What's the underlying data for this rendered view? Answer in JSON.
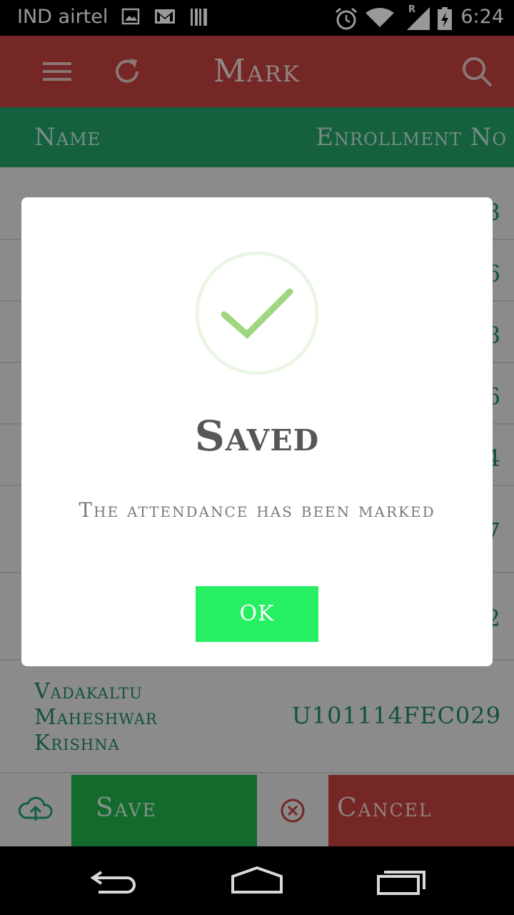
{
  "status_bar": {
    "carrier": "IND airtel",
    "time": "6:24",
    "roaming_indicator": "R",
    "icons": [
      "image-icon",
      "gmail-icon",
      "barcode-icon",
      "alarm-icon",
      "wifi-icon",
      "signal-icon",
      "battery-charging-icon"
    ]
  },
  "app_bar": {
    "title": "Mark",
    "menu_icon": "menu-icon",
    "refresh_icon": "refresh-icon",
    "search_icon": "search-icon",
    "color": "#c1423f"
  },
  "columns": {
    "name": "Name",
    "enrollment": "Enrollment No",
    "color": "#23a06a"
  },
  "rows": [
    {
      "name": "",
      "enrollment": "3"
    },
    {
      "name": "",
      "enrollment": "6"
    },
    {
      "name": "",
      "enrollment": "98"
    },
    {
      "name": "",
      "enrollment": "6"
    },
    {
      "name": "",
      "enrollment": "4"
    },
    {
      "name": "",
      "enrollment": "7"
    },
    {
      "name": "",
      "enrollment": "2"
    },
    {
      "name": "Vadakaltu Maheshwar Krishna",
      "enrollment": "U101114FEC029"
    }
  ],
  "bottom_bar": {
    "save_label": "Save",
    "cancel_label": "Cancel",
    "upload_icon": "cloud-upload-icon",
    "close_icon": "close-circle-icon",
    "save_color": "#1fb14c",
    "cancel_color": "#c1423f"
  },
  "dialog": {
    "title": "Saved",
    "message": "The attendance has been marked",
    "ok_label": "OK",
    "icon": "check-icon",
    "ok_color": "#26ef63"
  },
  "nav_bar": {
    "icons": [
      "back-icon",
      "home-icon",
      "recents-icon"
    ]
  }
}
